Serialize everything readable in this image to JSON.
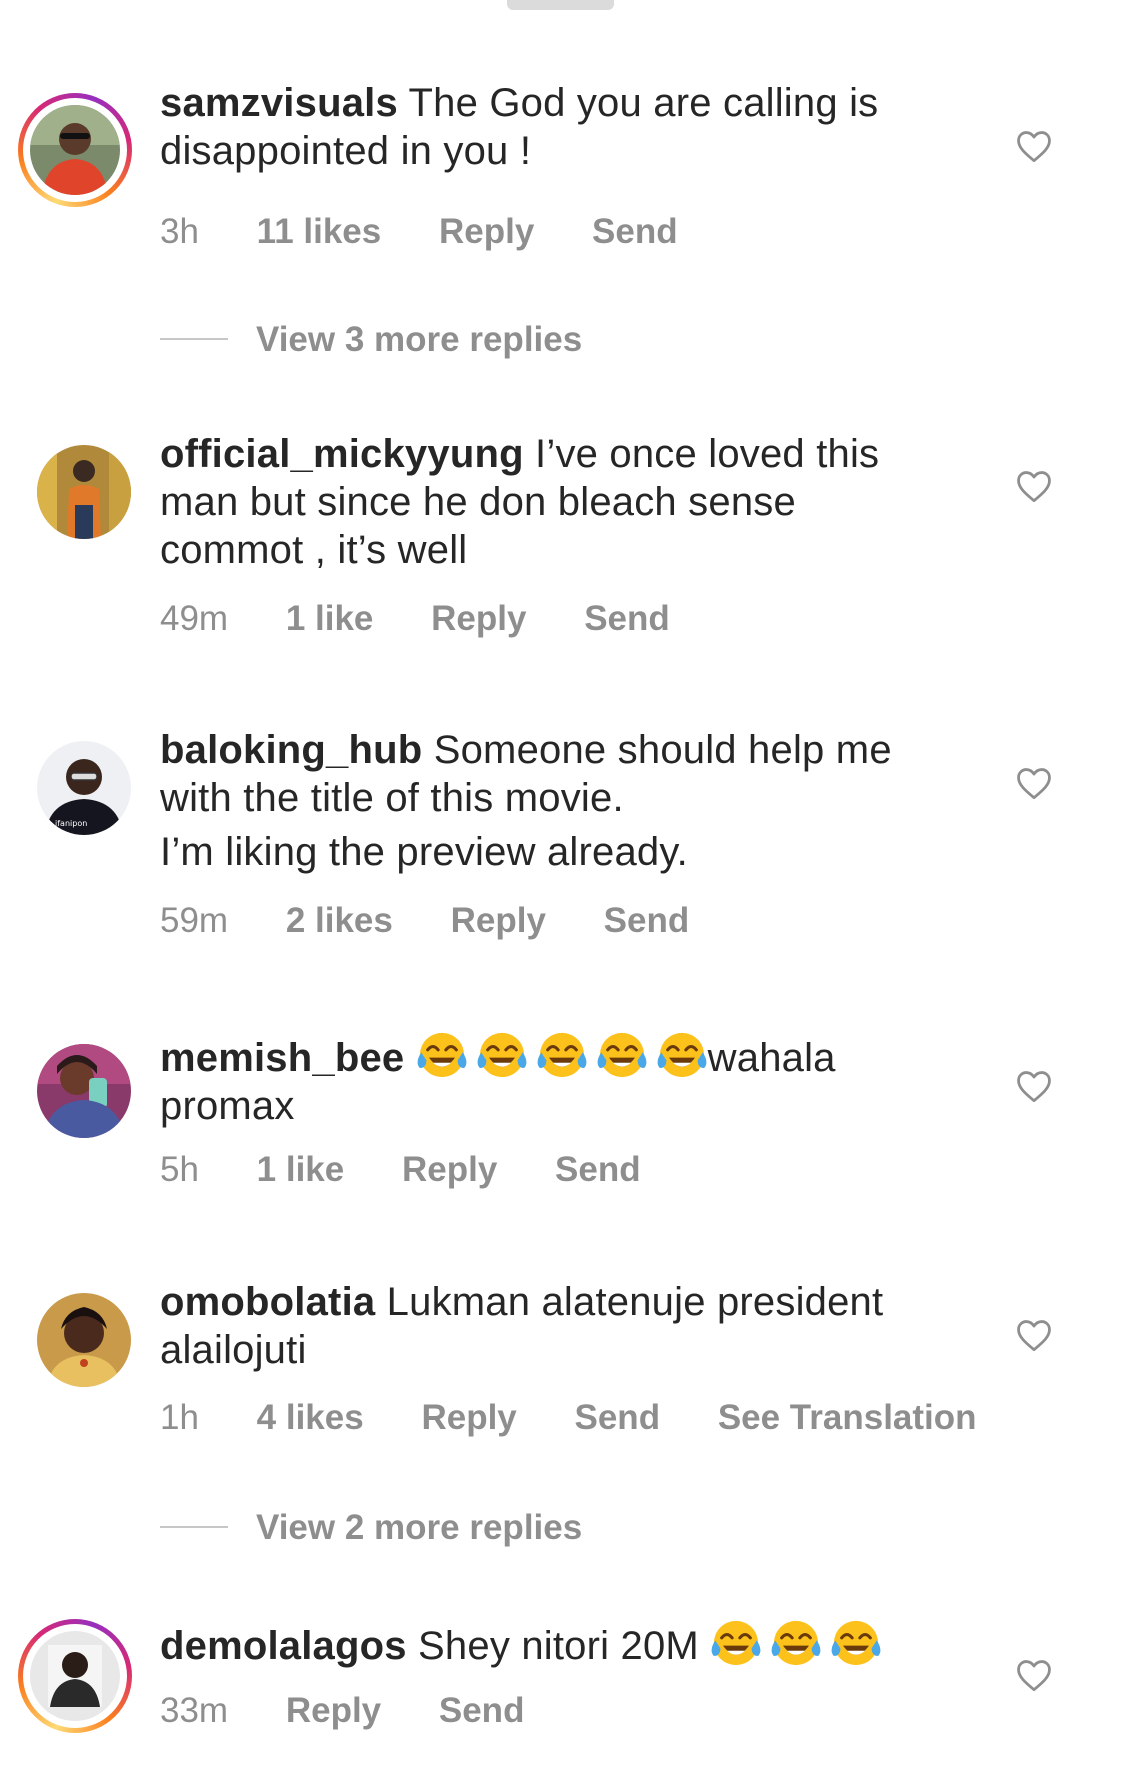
{
  "comments": [
    {
      "username": "samzvisuals",
      "text_lines": [
        "The God you are calling is",
        "disappointed in you !"
      ],
      "time": "3h",
      "likes": "11 likes",
      "reply": "Reply",
      "send": "Send",
      "has_story_ring": true,
      "avatar_colors": {
        "bg": "#7a8a6a",
        "shirt": "#e0452b",
        "skin": "#5a3a2a"
      }
    },
    {
      "username": "official_mickyyung",
      "text_lines": [
        "I’ve once loved this",
        "man but since he don bleach sense",
        "commot , it’s well"
      ],
      "time": "49m",
      "likes": "1 like",
      "reply": "Reply",
      "send": "Send",
      "has_story_ring": false,
      "avatar_colors": {
        "bg": "#b08a3a",
        "shirt": "#e07a2a",
        "skin": "#3a2a22"
      }
    },
    {
      "username": "baloking_hub",
      "text_lines": [
        "Someone should help me",
        "with the title of this movie.",
        "I’m liking the preview already."
      ],
      "time": "59m",
      "likes": "2 likes",
      "reply": "Reply",
      "send": "Send",
      "has_story_ring": false,
      "avatar_colors": {
        "bg": "#eef0f4",
        "shirt": "#151520",
        "skin": "#3a261c"
      }
    },
    {
      "username": "memish_bee",
      "text_after_emoji": "wahala",
      "text_line2": "promax",
      "emoji_count": 5,
      "time": "5h",
      "likes": "1 like",
      "reply": "Reply",
      "send": "Send",
      "has_story_ring": false,
      "avatar_colors": {
        "bg": "#8a3a6a",
        "shirt": "#4a5aa0",
        "skin": "#6a3a2a"
      }
    },
    {
      "username": "omobolatia",
      "text_lines": [
        "Lukman alatenuje president",
        "alailojuti"
      ],
      "time": "1h",
      "likes": "4 likes",
      "reply": "Reply",
      "send": "Send",
      "see_translation": "See Translation",
      "has_story_ring": false,
      "avatar_colors": {
        "bg": "#c89a4a",
        "shirt": "#e8c060",
        "skin": "#4a2a1c"
      }
    },
    {
      "username": "demolalagos",
      "text_before_emoji": "Shey nitori 20M",
      "emoji_count": 3,
      "time": "33m",
      "reply": "Reply",
      "send": "Send",
      "has_story_ring": true,
      "avatar_colors": {
        "bg": "#e8e8e8",
        "shirt": "#2a2a2a",
        "skin": "#2a1c16"
      }
    }
  ],
  "view_replies": [
    {
      "label": "View 3 more replies"
    },
    {
      "label": "View 2 more replies"
    }
  ],
  "icons": {
    "like": "heart-outline-icon",
    "emoji": "face-with-tears-of-joy-icon"
  },
  "colors": {
    "text": "#262626",
    "secondary": "#8e8e8e"
  }
}
